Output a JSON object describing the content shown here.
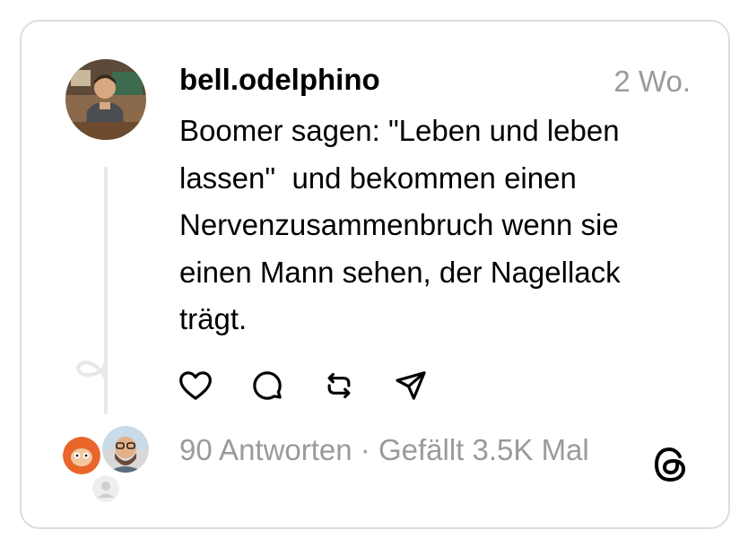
{
  "post": {
    "username": "bell.odelphino",
    "timestamp": "2 Wo.",
    "text_lines": [
      "Boomer sagen: \"Leben und leben",
      "lassen\"  und bekommen einen",
      "Nervenzusammenbruch wenn sie",
      "einen Mann sehen, der Nagellack",
      "trägt."
    ]
  },
  "stats": {
    "replies": "90 Antworten",
    "separator": " · ",
    "likes": "Gefällt 3.5K Mal"
  },
  "icons": {
    "like": "heart-icon",
    "reply": "comment-icon",
    "repost": "repost-icon",
    "share": "send-icon",
    "brand": "threads-logo-icon"
  },
  "colors": {
    "text": "#000000",
    "muted": "#9a9a9a",
    "border": "#dddddd"
  }
}
